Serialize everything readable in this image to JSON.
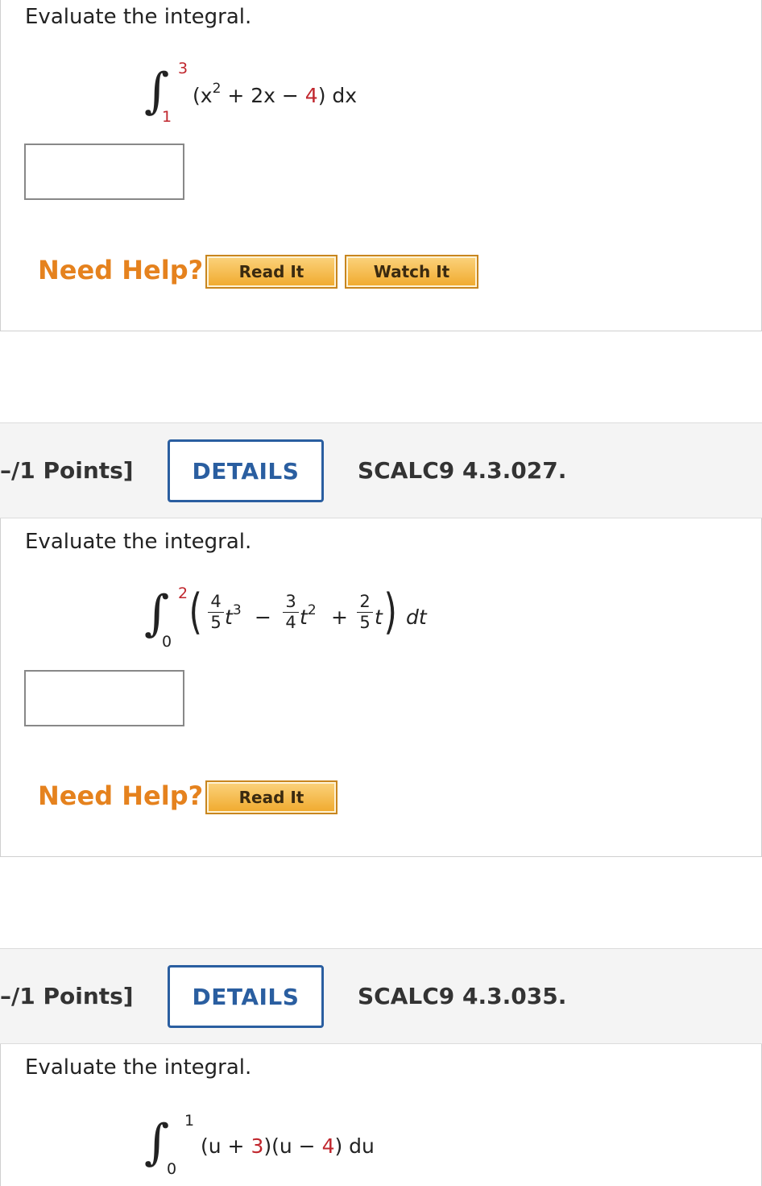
{
  "q1": {
    "prompt": "Evaluate the integral.",
    "upper": "3",
    "lower": "1",
    "integrand_open": "(x",
    "integrand_exp": "2",
    "integrand_mid": " + 2x − ",
    "integrand_const": "4",
    "integrand_close": ") dx",
    "help_label": "Need Help?",
    "read_it": "Read It",
    "watch_it": "Watch It"
  },
  "q2": {
    "points": "–/1 Points]",
    "details": "DETAILS",
    "code": "SCALC9 4.3.027.",
    "prompt": "Evaluate the integral.",
    "upper": "2",
    "lower": "0",
    "f1_num": "4",
    "f1_den": "5",
    "t1": "t",
    "e1": "3",
    "op1": "−",
    "f2_num": "3",
    "f2_den": "4",
    "t2": "t",
    "e2": "2",
    "op2": "+",
    "f3_num": "2",
    "f3_den": "5",
    "t3": "t",
    "dvar": "dt",
    "help_label": "Need Help?",
    "read_it": "Read It"
  },
  "q3": {
    "points": "–/1 Points]",
    "details": "DETAILS",
    "code": "SCALC9 4.3.035.",
    "prompt": "Evaluate the integral.",
    "upper": "1",
    "lower": "0",
    "p1": "(u + ",
    "c1": "3",
    "p2": ")(u − ",
    "c2": "4",
    "p3": ") du"
  }
}
